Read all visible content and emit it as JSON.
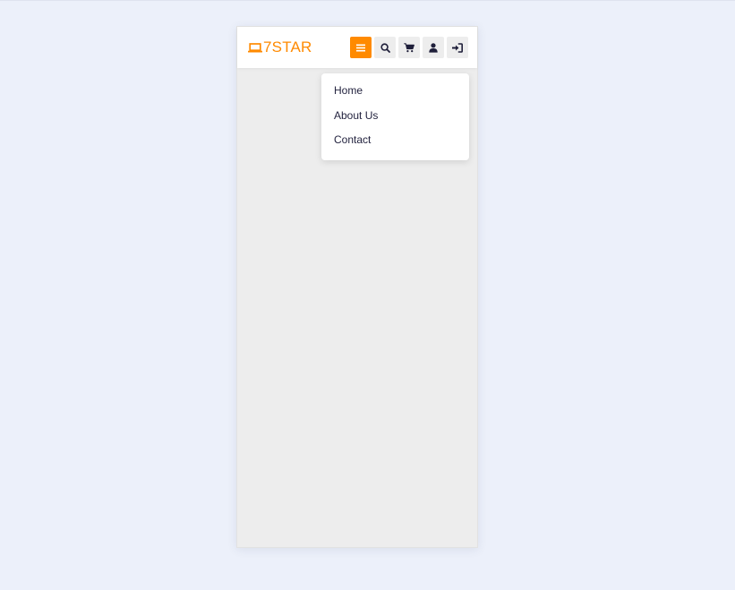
{
  "brand": {
    "logo_text": "7STAR",
    "accent_color": "#ff8a00",
    "logo_icon": "laptop-icon"
  },
  "toolbar": {
    "buttons": [
      {
        "icon": "hamburger-menu-icon",
        "active": true
      },
      {
        "icon": "search-icon",
        "active": false
      },
      {
        "icon": "cart-icon",
        "active": false
      },
      {
        "icon": "user-icon",
        "active": false
      },
      {
        "icon": "sign-in-icon",
        "active": false
      }
    ]
  },
  "menu": {
    "items": [
      {
        "label": "Home"
      },
      {
        "label": "About Us"
      },
      {
        "label": "Contact"
      }
    ]
  },
  "colors": {
    "page_background": "#ecf0fa",
    "content_background": "#ededed",
    "text_dark": "#23233f"
  }
}
